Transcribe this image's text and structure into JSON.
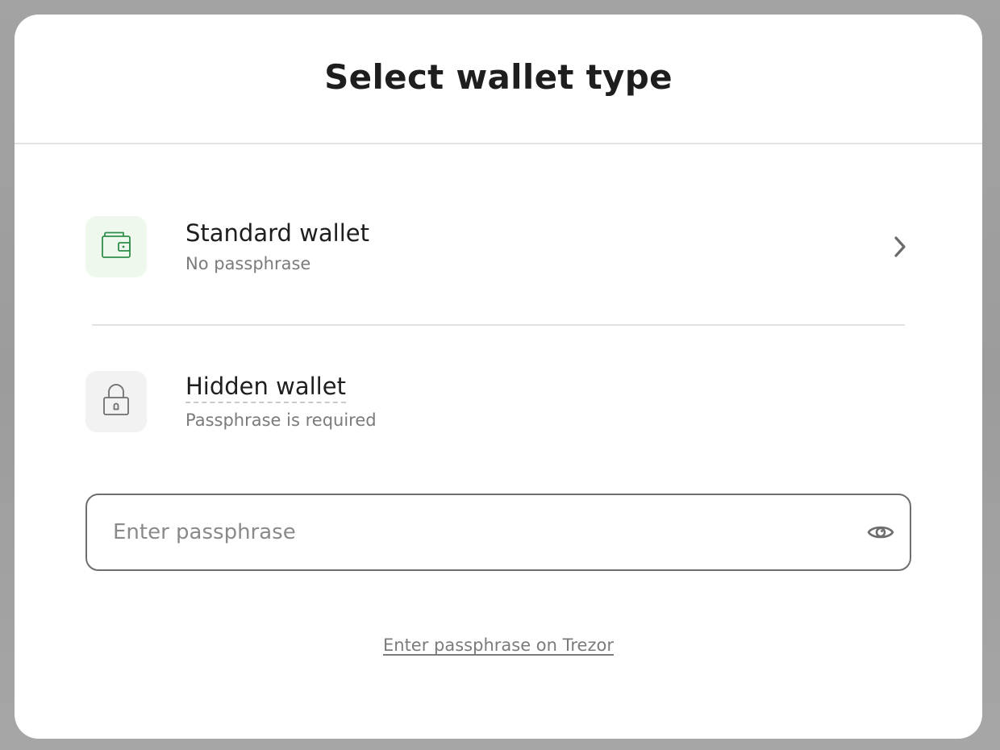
{
  "modal": {
    "title": "Select wallet type"
  },
  "options": [
    {
      "title": "Standard wallet",
      "subtitle": "No passphrase",
      "icon": "wallet-icon",
      "icon_color": "#2f8f4a",
      "icon_bg": "#eff8ec"
    },
    {
      "title": "Hidden wallet",
      "subtitle": "Passphrase is required",
      "icon": "lock-icon",
      "icon_color": "#6e6e6e",
      "icon_bg": "#f2f2f2"
    }
  ],
  "passphrase": {
    "value": "",
    "placeholder": "Enter passphrase",
    "toggle_icon": "eye-icon"
  },
  "footer": {
    "link_label": "Enter passphrase on Trezor"
  }
}
